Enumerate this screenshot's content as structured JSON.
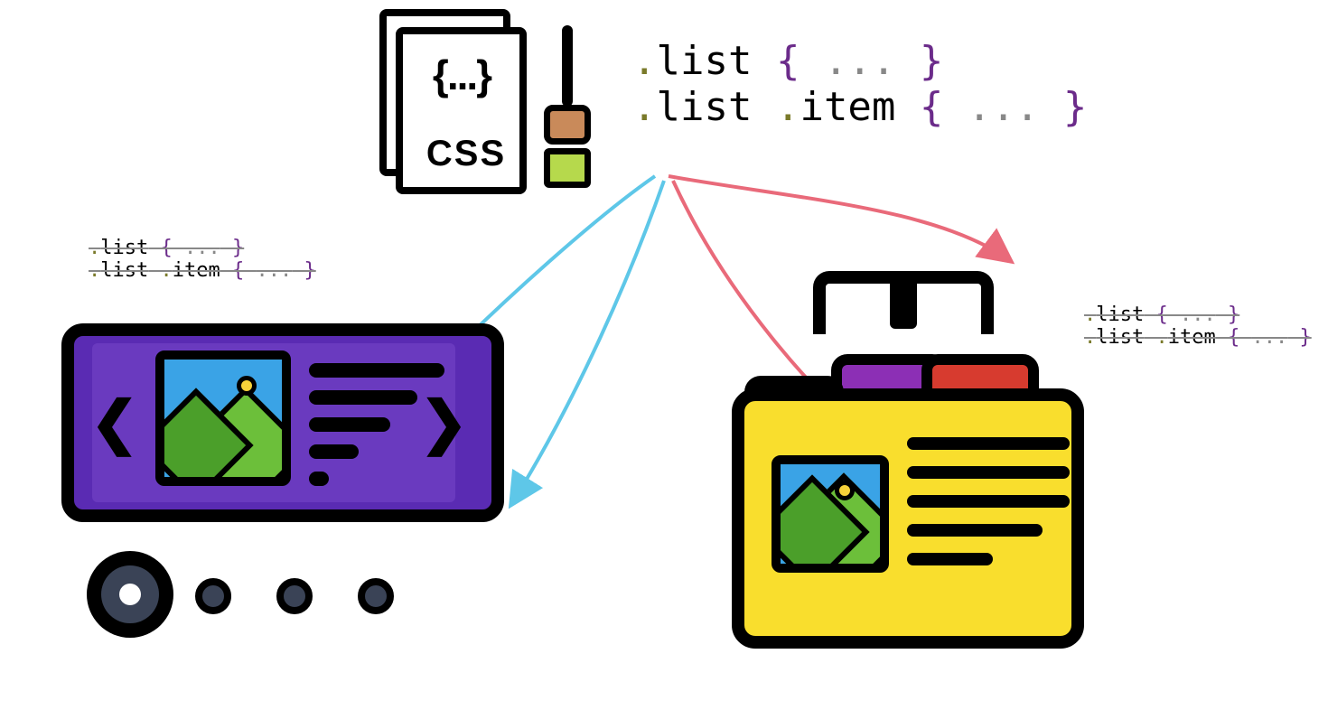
{
  "css_file": {
    "label": "CSS",
    "braces": "{...}"
  },
  "code_main": {
    "line1": {
      "dot": ".",
      "cls": "list",
      "open": " { ",
      "body": "...",
      "close": " }"
    },
    "line2": {
      "dot1": ".",
      "cls1": "list",
      "dot2": " .",
      "cls2": "item",
      "open": " { ",
      "body": "...",
      "close": " }"
    }
  },
  "code_left": {
    "line1": {
      "dot": ".",
      "cls": "list",
      "open": " { ",
      "body": "...",
      "close": " }"
    },
    "line2": {
      "dot1": ".",
      "cls1": "list",
      "dot2": " .",
      "cls2": "item",
      "open": " { ",
      "body": "...",
      "close": " }"
    }
  },
  "code_right": {
    "line1": {
      "dot": ".",
      "cls": "list",
      "open": " { ",
      "body": "...",
      "close": " }"
    },
    "line2": {
      "dot1": ".",
      "cls1": "list",
      "dot2": " .",
      "cls2": "item",
      "open": " { ",
      "body": "...",
      "close": " }"
    }
  },
  "colors": {
    "purple": "#5a2bb3",
    "yellow": "#f9de2d",
    "arrow_blue": "#5ec7e8",
    "arrow_red": "#e96a7a",
    "brace": "#6b2b8a"
  }
}
